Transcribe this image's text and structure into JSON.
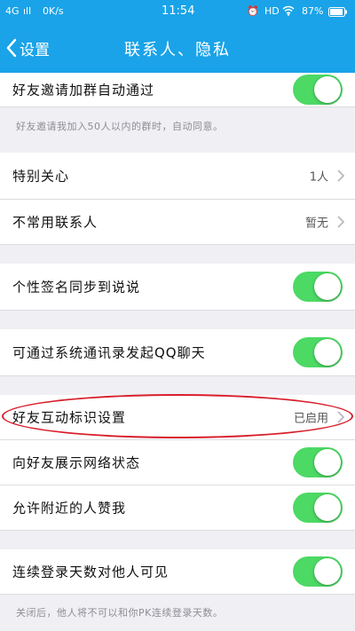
{
  "status": {
    "network": "4G",
    "signal": "ıll",
    "speed": "0K/s",
    "time": "11:54",
    "hd": "HD",
    "battery": "87%"
  },
  "nav": {
    "back_label": "设置",
    "title": "联系人、隐私"
  },
  "rows": {
    "auto_accept": {
      "label": "好友邀请加群自动通过",
      "on": true
    },
    "auto_accept_note": "好友邀请我加入50人以内的群时，自动同意。",
    "special_care": {
      "label": "特别关心",
      "value": "1人"
    },
    "rare_contacts": {
      "label": "不常用联系人",
      "value": "暂无"
    },
    "signature_sync": {
      "label": "个性签名同步到说说",
      "on": true
    },
    "contacts_chat": {
      "label": "可通过系统通讯录发起QQ聊天",
      "on": true
    },
    "interaction_mark": {
      "label": "好友互动标识设置",
      "value": "已启用"
    },
    "network_status": {
      "label": "向好友展示网络状态",
      "on": true
    },
    "nearby_like": {
      "label": "允许附近的人赞我",
      "on": true
    },
    "login_days": {
      "label": "连续登录天数对他人可见",
      "on": true
    },
    "login_days_note": "关闭后，他人将不可以和你PK连续登录天数。"
  },
  "colors": {
    "accent": "#1aa3e8",
    "toggle_on": "#4cd964",
    "highlight": "#d81e2b"
  }
}
